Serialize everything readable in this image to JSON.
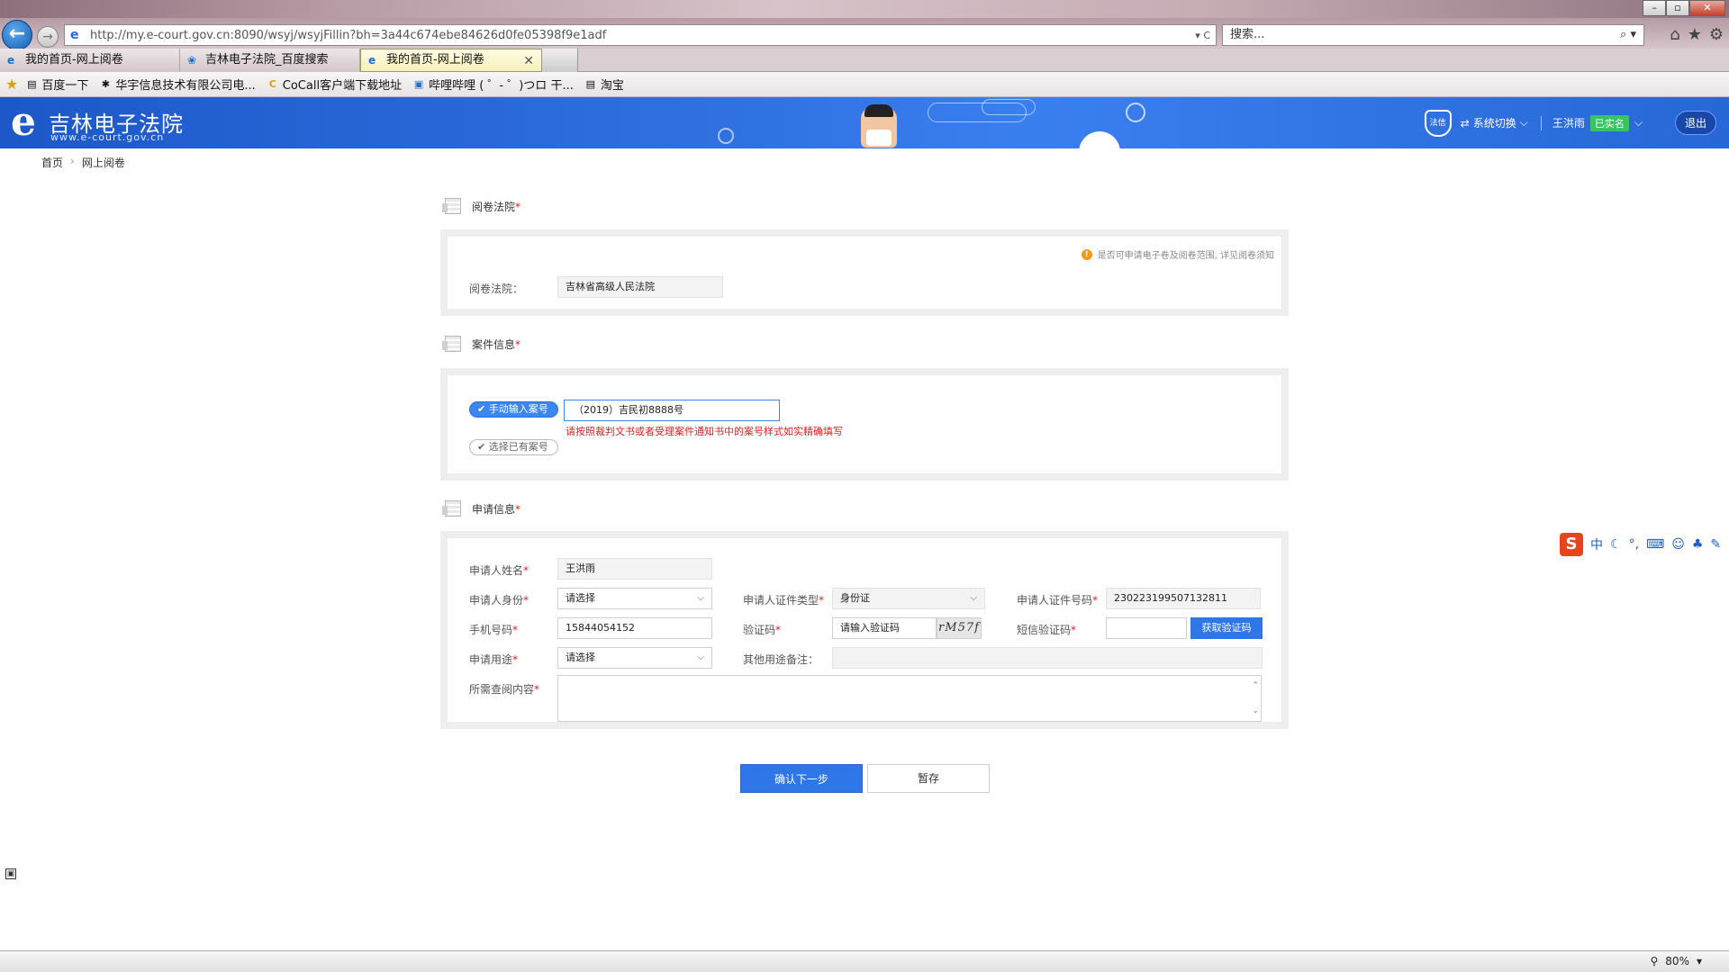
{
  "browser": {
    "window_controls": [
      "–",
      "▫",
      "✕"
    ],
    "address": "http://my.e-court.gov.cn:8090/wsyj/wsyjFillin?bh=3a44c674ebe84626d0fe05398f9e1adf",
    "address_tools": "▾ C",
    "search_placeholder": "搜索...",
    "tabs": [
      {
        "label": "我的首页-网上阅卷"
      },
      {
        "label": "吉林电子法院_百度搜索"
      },
      {
        "label": "我的首页-网上阅卷"
      }
    ],
    "favorites": [
      {
        "label": "百度一下"
      },
      {
        "label": "华宇信息技术有限公司电..."
      },
      {
        "label": "CoCall客户端下载地址"
      },
      {
        "label": "哔哩哔哩 ( ゜- ゜)つロ 干..."
      },
      {
        "label": "淘宝"
      }
    ],
    "zoom": "80%"
  },
  "site": {
    "logo_text": "吉林电子法院",
    "logo_url": "www.e-court.gov.cn",
    "shield_label": "法信",
    "system_switch": "系统切换",
    "user_name": "王洪雨",
    "verified_badge": "已实名",
    "logout": "退出"
  },
  "breadcrumb": {
    "home": "首页",
    "current": "网上阅卷"
  },
  "sections": {
    "court": {
      "title": "阅卷法院",
      "hint": "是否可申请电子卷及阅卷范围, 详见阅卷须知",
      "field_label": "阅卷法院：",
      "field_value": "吉林省高级人民法院"
    },
    "case": {
      "title": "案件信息",
      "manual_option": "手动输入案号",
      "select_option": "选择已有案号",
      "case_number": "（2019）吉民初8888号",
      "error": "请按照裁判文书或者受理案件通知书中的案号样式如实精确填写"
    },
    "applicant": {
      "title": "申请信息",
      "name_label": "申请人姓名",
      "name_value": "王洪雨",
      "identity_label": "申请人身份",
      "identity_value": "请选择",
      "id_type_label": "申请人证件类型",
      "id_type_value": "身份证",
      "id_number_label": "申请人证件号码",
      "id_number_value": "230223199507132811",
      "phone_label": "手机号码",
      "phone_value": "15844054152",
      "captcha_label": "验证码",
      "captcha_placeholder": "请输入验证码",
      "captcha_image": "rM57f",
      "sms_label": "短信验证码",
      "sms_button": "获取验证码",
      "purpose_label": "申请用途",
      "purpose_value": "请选择",
      "other_purpose_label": "其他用途备注：",
      "content_label": "所需查阅内容"
    }
  },
  "actions": {
    "confirm": "确认下一步",
    "save": "暂存"
  },
  "ime": {
    "logo": "S",
    "mode": "中"
  }
}
